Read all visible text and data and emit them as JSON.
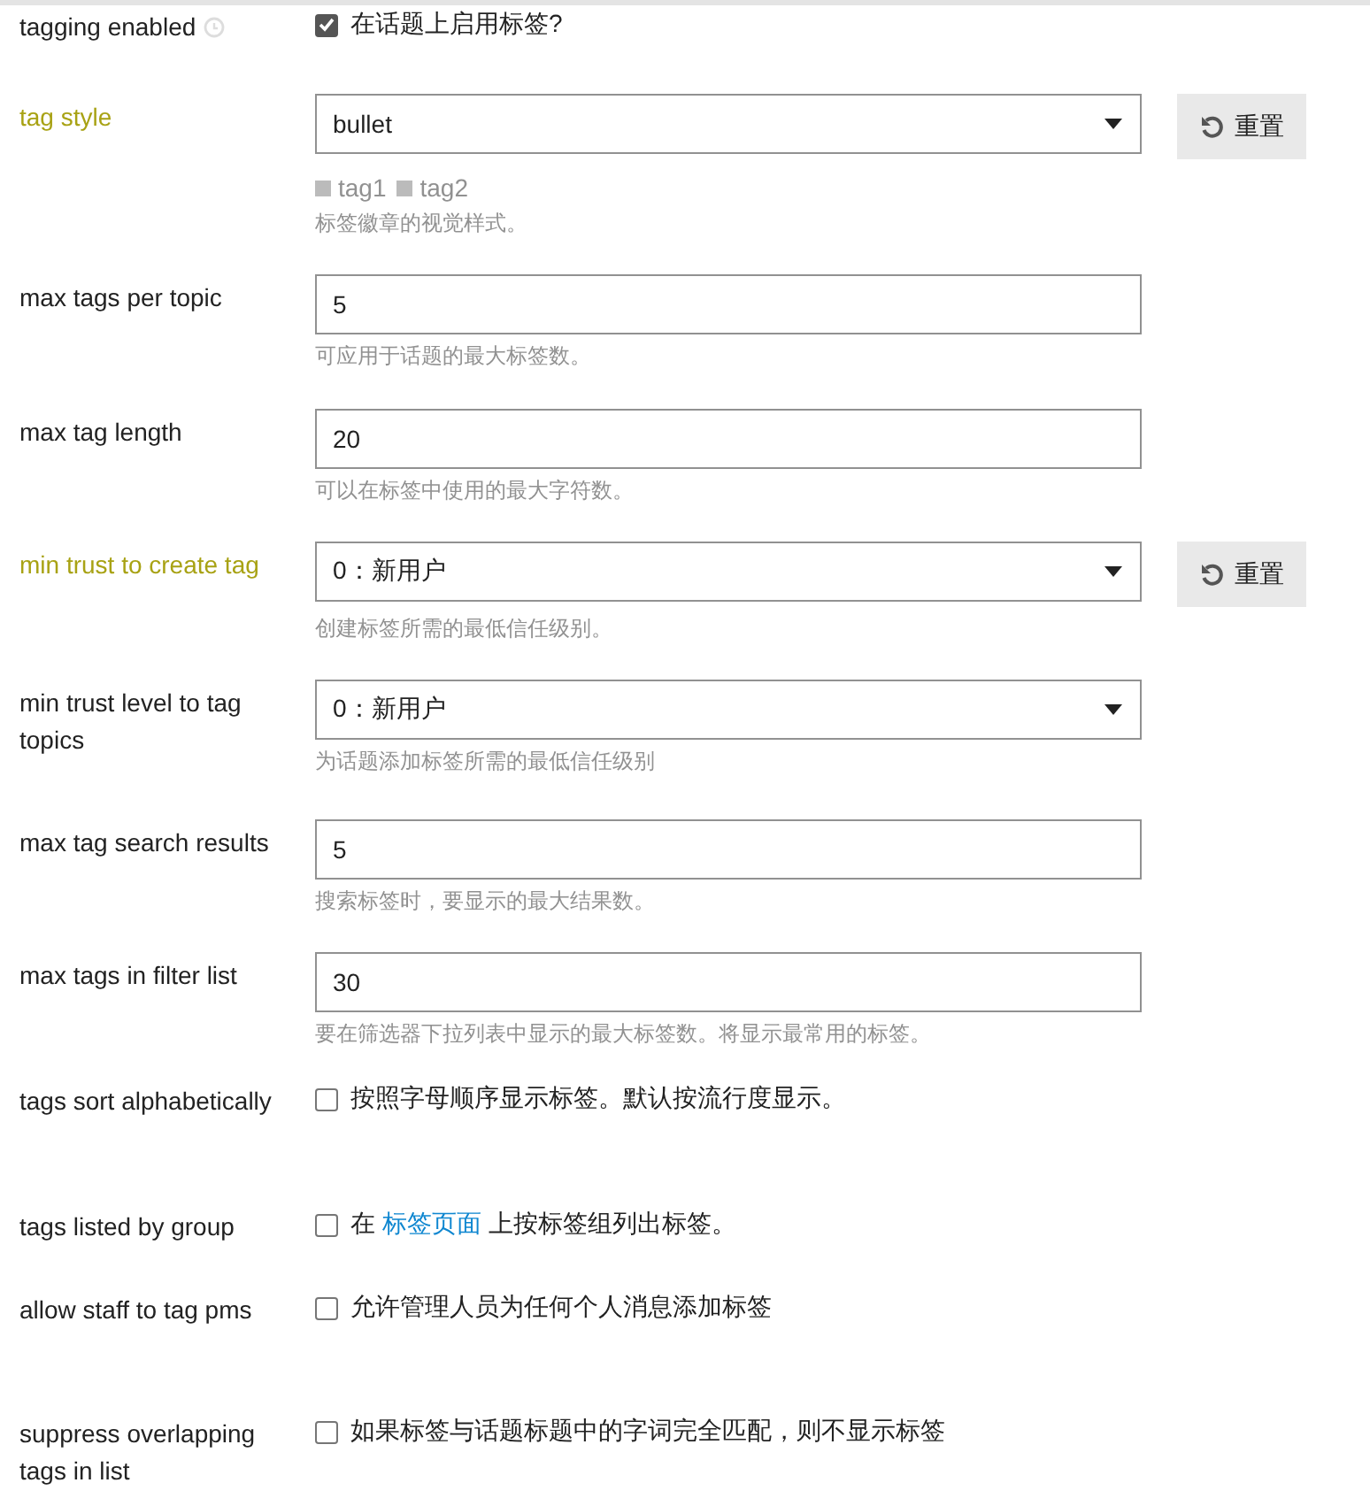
{
  "settings": [
    {
      "kind": "checkbox",
      "label": "tagging enabled",
      "history_icon": true,
      "overridden": false,
      "checked": true,
      "text": "在话题上启用标签?"
    },
    {
      "kind": "select",
      "label": "tag style",
      "overridden": true,
      "value": "bullet",
      "preview": [
        "tag1",
        "tag2"
      ],
      "reset": "重置",
      "description": "标签徽章的视觉样式。"
    },
    {
      "kind": "text",
      "label": "max tags per topic",
      "overridden": false,
      "value": "5",
      "description": "可应用于话题的最大标签数。"
    },
    {
      "kind": "text",
      "label": "max tag length",
      "overridden": false,
      "value": "20",
      "description": "可以在标签中使用的最大字符数。"
    },
    {
      "kind": "select",
      "label": "min trust to create tag",
      "overridden": true,
      "value": "0：新用户",
      "reset": "重置",
      "description": "创建标签所需的最低信任级别。"
    },
    {
      "kind": "select",
      "label": "min trust level to tag topics",
      "overridden": false,
      "value": "0：新用户",
      "description": "为话题添加标签所需的最低信任级别"
    },
    {
      "kind": "text",
      "label": "max tag search results",
      "overridden": false,
      "value": "5",
      "description": "搜索标签时，要显示的最大结果数。"
    },
    {
      "kind": "text",
      "label": "max tags in filter list",
      "overridden": false,
      "value": "30",
      "description": "要在筛选器下拉列表中显示的最大标签数。将显示最常用的标签。"
    },
    {
      "kind": "checkbox",
      "label": "tags sort alphabetically",
      "overridden": false,
      "checked": false,
      "text": "按照字母顺序显示标签。默认按流行度显示。"
    },
    {
      "kind": "checkbox",
      "label": "tags listed by group",
      "overridden": false,
      "checked": false,
      "text_before": "在",
      "link": "标签页面",
      "text_after": "上按标签组列出标签。"
    },
    {
      "kind": "checkbox",
      "label": "allow staff to tag pms",
      "overridden": false,
      "checked": false,
      "text": "允许管理人员为任何个人消息添加标签"
    },
    {
      "kind": "checkbox",
      "label": "suppress overlapping tags in list",
      "overridden": false,
      "checked": false,
      "text": "如果标签与话题标题中的字词完全匹配，则不显示标签"
    }
  ]
}
